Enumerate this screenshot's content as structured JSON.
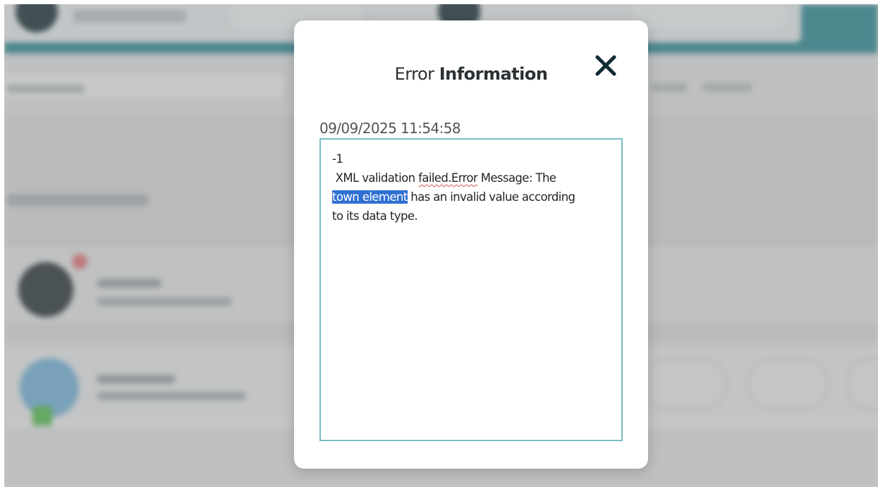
{
  "modal": {
    "title_light": "Error",
    "title_bold": "Information",
    "timestamp": "09/09/2025 11:54:58",
    "error": {
      "code": "-1",
      "line1_pre": " XML validation ",
      "line1_misspelled": "failed.Error",
      "line1_post": " Message: The",
      "line2_selected": "town element",
      "line2_post": " has an invalid value according",
      "line3": "to its data type."
    }
  },
  "colors": {
    "accent": "#3e8f99",
    "border": "#79bcc4",
    "selection": "#2e6fd1",
    "close_icon": "#0f2a33"
  },
  "icons": {
    "close": "close-icon"
  }
}
